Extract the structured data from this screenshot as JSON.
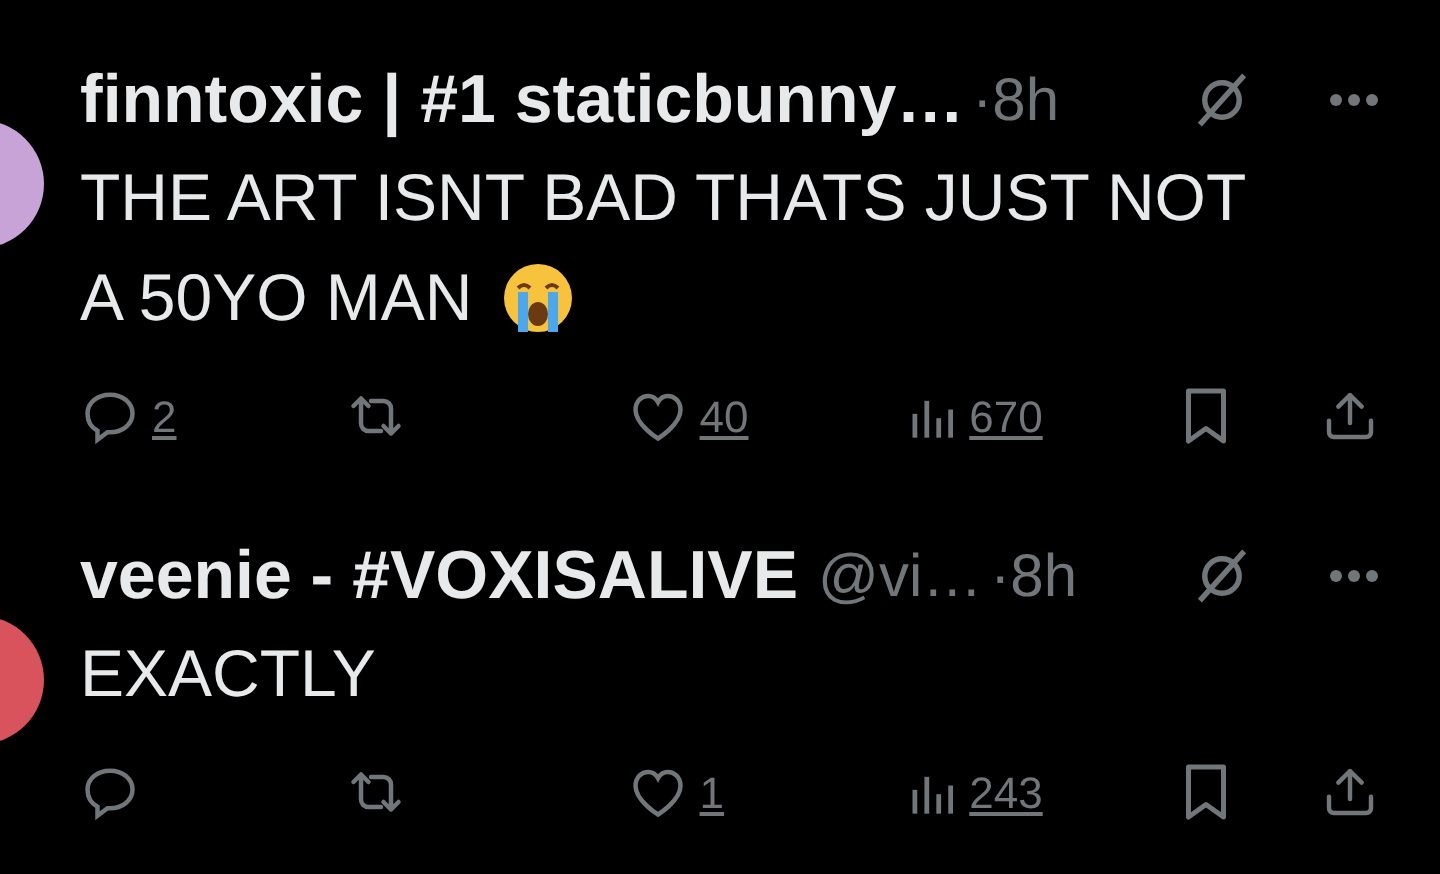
{
  "tweets": [
    {
      "name": "finntoxic | #1 staticbunny…",
      "time": "·8h",
      "text": [
        "THE ART ISNT BAD THATS JUST NOT",
        "A 50YO MAN"
      ],
      "emoji": true,
      "actions": [
        {
          "kind": "reply",
          "count": "2"
        },
        {
          "kind": "retweet"
        },
        {
          "kind": "like",
          "count": "40"
        },
        {
          "kind": "views",
          "count": "670"
        },
        {
          "kind": "bookmark"
        },
        {
          "kind": "share"
        }
      ]
    },
    {
      "name": "veenie - #VOXISALIVE",
      "handle": "@vi…",
      "time": "·8h",
      "text": [
        "EXACTLY"
      ],
      "actions": [
        {
          "kind": "reply"
        },
        {
          "kind": "retweet"
        },
        {
          "kind": "like",
          "count": "1"
        },
        {
          "kind": "views",
          "count": "243"
        },
        {
          "kind": "bookmark"
        },
        {
          "kind": "share"
        }
      ]
    }
  ]
}
